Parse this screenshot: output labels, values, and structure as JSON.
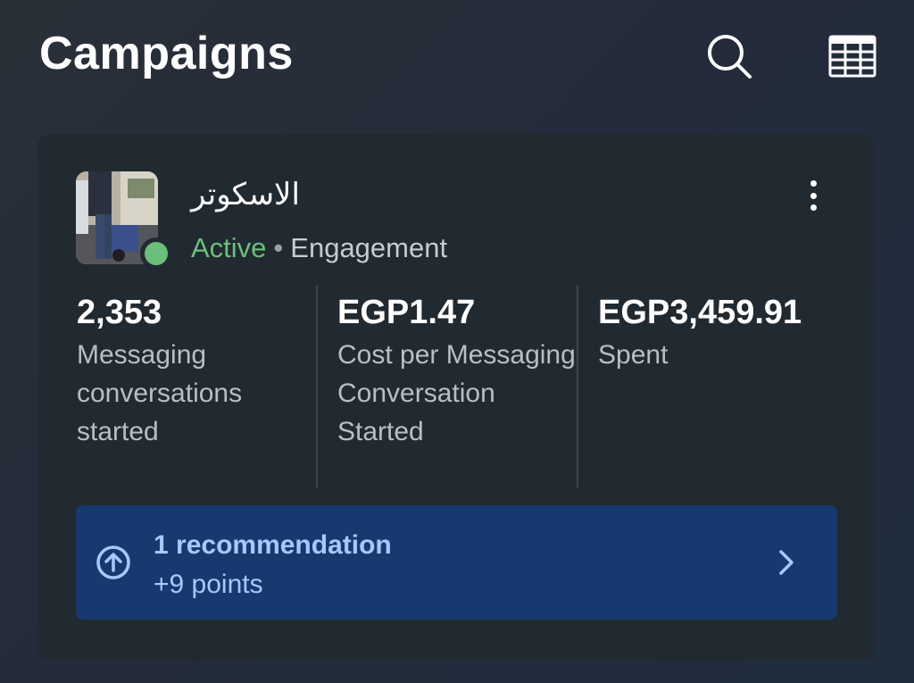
{
  "header": {
    "title": "Campaigns",
    "icons": [
      "search-icon",
      "table-icon"
    ]
  },
  "campaign": {
    "name": "الاسكوتر",
    "status": "Active",
    "separator": "•",
    "objective": "Engagement",
    "status_color": "#6bbf7a"
  },
  "metrics": [
    {
      "value": "2,353",
      "label": "Messaging conversations started"
    },
    {
      "value": "EGP1.47",
      "label": "Cost per Messaging Conversation Started"
    },
    {
      "value": "EGP3,459.91",
      "label": "Spent"
    }
  ],
  "recommendation": {
    "title": "1 recommendation",
    "subtitle": "+9 points",
    "accent_color": "#a8c7ff",
    "background_color": "#18396f"
  }
}
